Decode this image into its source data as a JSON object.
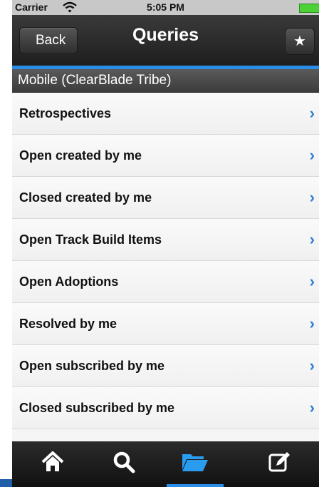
{
  "status_bar": {
    "carrier": "Carrier",
    "time": "5:05 PM"
  },
  "nav": {
    "back_label": "Back",
    "title": "Queries",
    "star_icon": "star-icon"
  },
  "section": {
    "title": "Mobile (ClearBlade Tribe)"
  },
  "queries": [
    "Retrospectives",
    "Open created by me",
    "Closed created by me",
    "Open Track Build Items",
    "Open Adoptions",
    "Resolved by me",
    "Open subscribed by me",
    "Closed subscribed by me"
  ],
  "tabbar": {
    "tabs": [
      "home-icon",
      "search-icon",
      "folder-icon",
      "compose-icon"
    ],
    "active_index": 2,
    "accent": "#2a8ee8"
  }
}
